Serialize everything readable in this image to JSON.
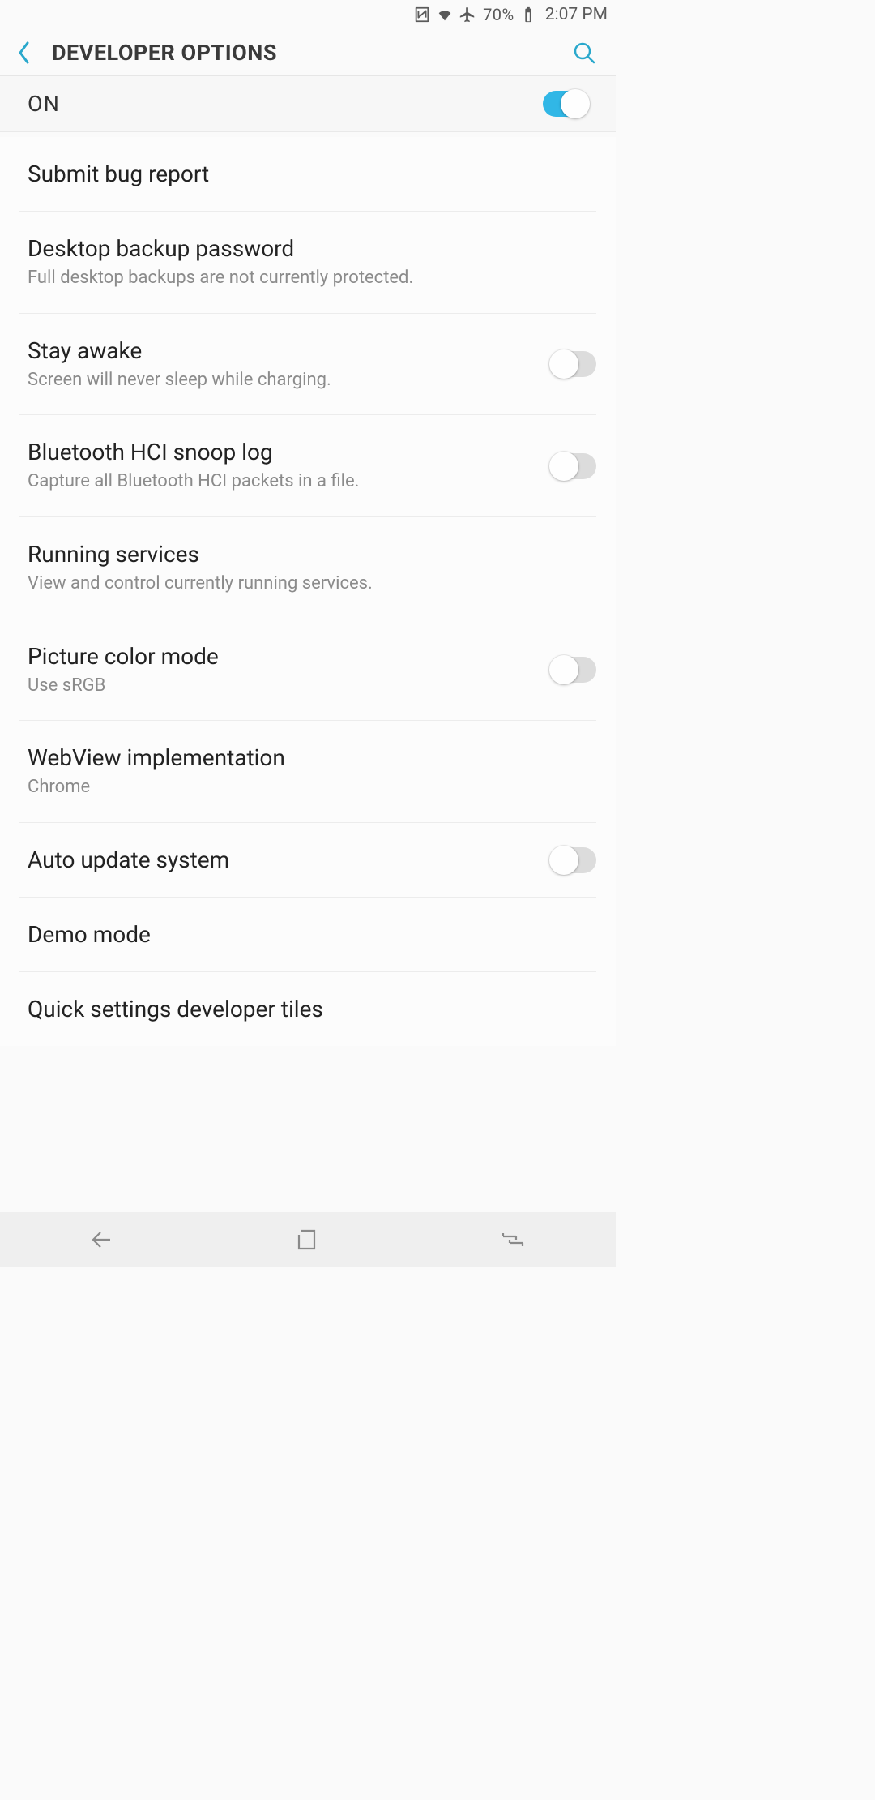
{
  "status": {
    "battery_text": "70%",
    "clock": "2:07 PM"
  },
  "header": {
    "title": "DEVELOPER OPTIONS"
  },
  "master": {
    "label": "ON",
    "enabled": true
  },
  "items": [
    {
      "title": "Submit bug report",
      "sub": null,
      "toggle": null
    },
    {
      "title": "Desktop backup password",
      "sub": "Full desktop backups are not currently protected.",
      "toggle": null
    },
    {
      "title": "Stay awake",
      "sub": "Screen will never sleep while charging.",
      "toggle": false
    },
    {
      "title": "Bluetooth HCI snoop log",
      "sub": "Capture all Bluetooth HCI packets in a file.",
      "toggle": false
    },
    {
      "title": "Running services",
      "sub": "View and control currently running services.",
      "toggle": null
    },
    {
      "title": "Picture color mode",
      "sub": "Use sRGB",
      "toggle": false
    },
    {
      "title": "WebView implementation",
      "sub": "Chrome",
      "toggle": null
    },
    {
      "title": "Auto update system",
      "sub": null,
      "toggle": false
    },
    {
      "title": "Demo mode",
      "sub": null,
      "toggle": null
    },
    {
      "title": "Quick settings developer tiles",
      "sub": null,
      "toggle": null
    }
  ]
}
